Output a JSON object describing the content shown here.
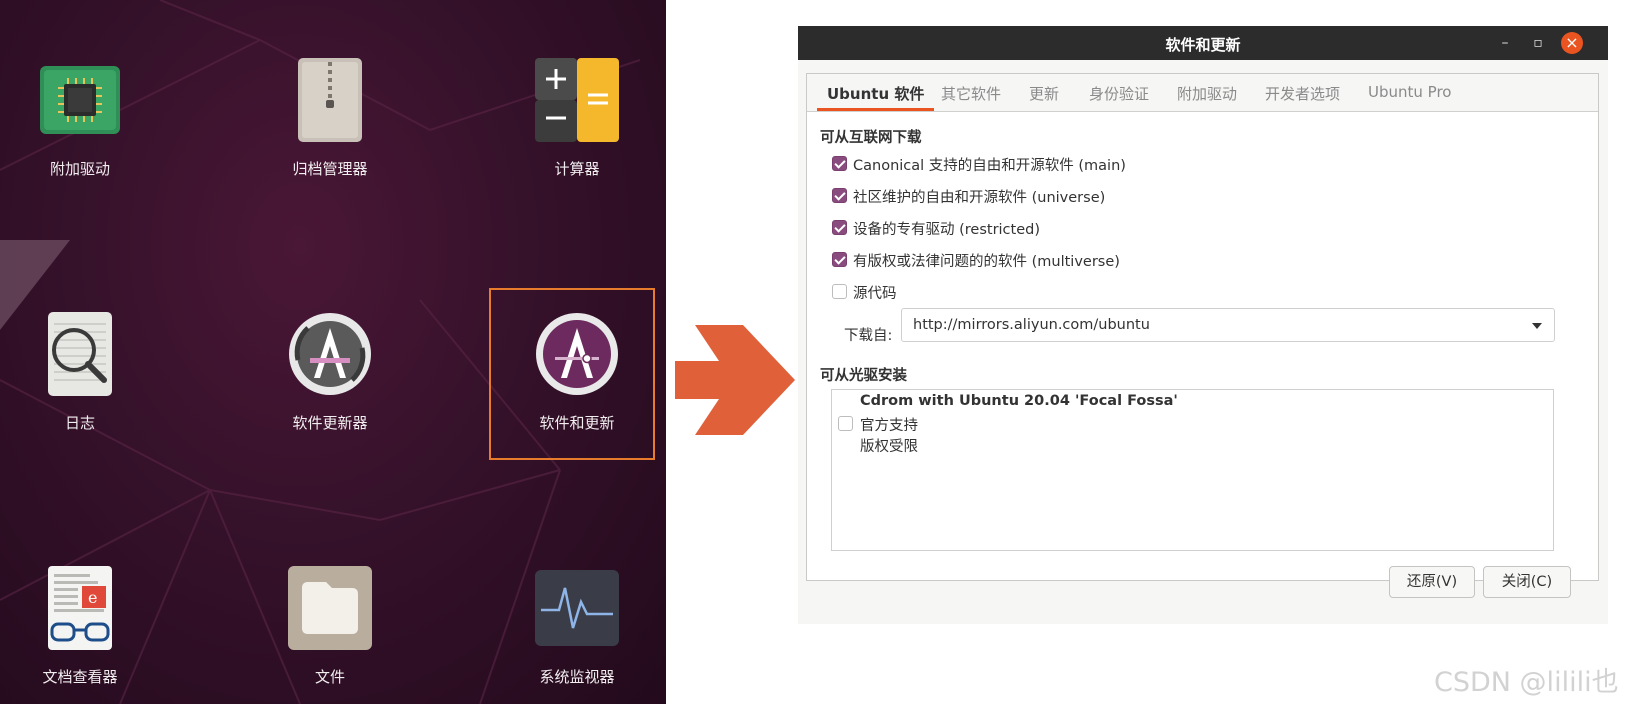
{
  "launcher": {
    "apps": [
      {
        "label": "附加驱动",
        "icon": "chip-icon"
      },
      {
        "label": "归档管理器",
        "icon": "archive-icon"
      },
      {
        "label": "计算器",
        "icon": "calculator-icon"
      },
      {
        "label": "日志",
        "icon": "magnifier-log-icon"
      },
      {
        "label": "软件更新器",
        "icon": "software-updater-icon"
      },
      {
        "label": "软件和更新",
        "icon": "software-properties-icon"
      },
      {
        "label": "文档查看器",
        "icon": "document-viewer-icon"
      },
      {
        "label": "文件",
        "icon": "folder-icon"
      },
      {
        "label": "系统监视器",
        "icon": "system-monitor-icon"
      }
    ],
    "selected": "软件和更新"
  },
  "arrow": {
    "color": "#e0603a"
  },
  "dialog": {
    "title": "软件和更新",
    "tabs": [
      "Ubuntu 软件",
      "其它软件",
      "更新",
      "身份验证",
      "附加驱动",
      "开发者选项",
      "Ubuntu Pro"
    ],
    "active_tab": "Ubuntu 软件",
    "internet_section": "可从互联网下载",
    "sources": [
      {
        "label": "Canonical 支持的自由和开源软件 (main)",
        "checked": true
      },
      {
        "label": "社区维护的自由和开源软件 (universe)",
        "checked": true
      },
      {
        "label": "设备的专有驱动 (restricted)",
        "checked": true
      },
      {
        "label": "有版权或法律问题的的软件 (multiverse)",
        "checked": true
      },
      {
        "label": "源代码",
        "checked": false
      }
    ],
    "download_from_label": "下载自:",
    "download_from_value": "http://mirrors.aliyun.com/ubuntu",
    "cdrom_section": "可从光驱安装",
    "cdrom": {
      "title": "Cdrom with Ubuntu 20.04 'Focal Fossa'",
      "line1": "官方支持",
      "line2": "版权受限",
      "checked": false
    },
    "buttons": {
      "revert": "还原(V)",
      "close": "关闭(C)"
    },
    "accent": "#e95420",
    "check_color": "#8a4b7e"
  },
  "watermark": "CSDN @lilili也"
}
